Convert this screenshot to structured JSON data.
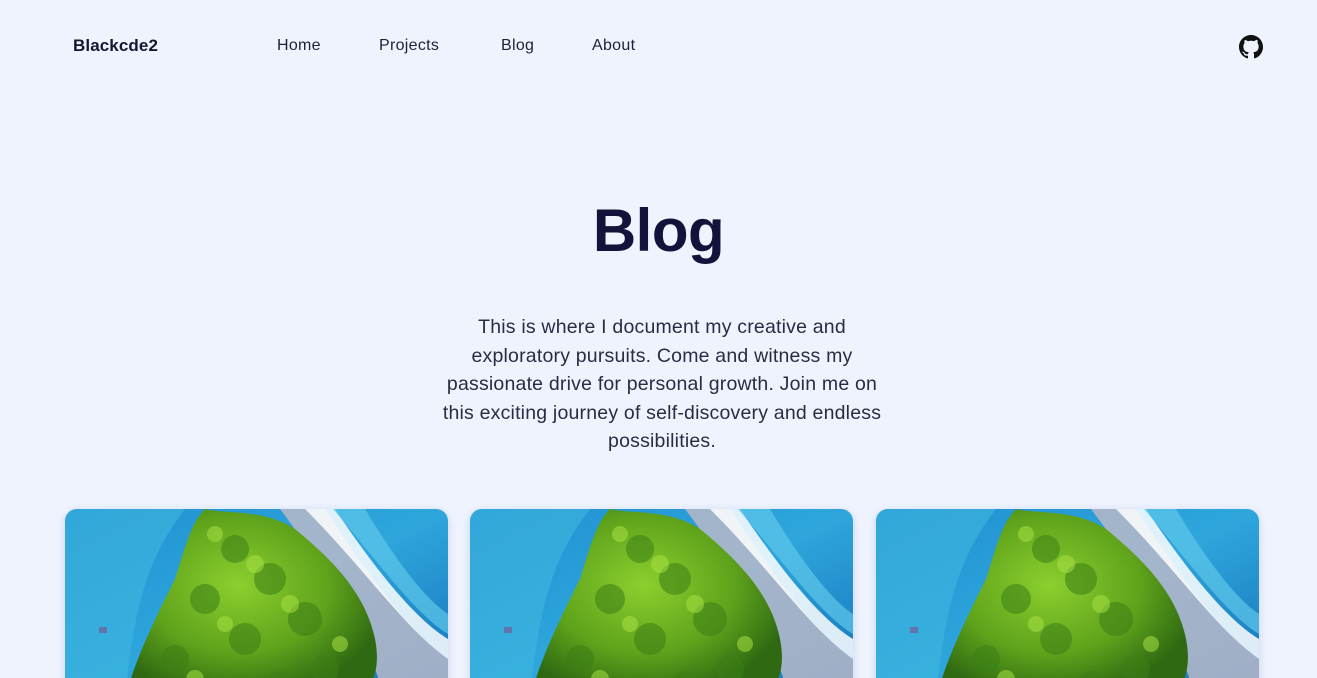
{
  "nav": {
    "brand": "Blackcde2",
    "links": [
      {
        "label": "Home"
      },
      {
        "label": "Projects"
      },
      {
        "label": "Blog"
      },
      {
        "label": "About"
      }
    ],
    "github_icon": "github-icon"
  },
  "hero": {
    "title": "Blog",
    "description": "This is where I document my creative and exploratory pursuits. Come and witness my passionate drive for personal growth. Join me on this exciting journey of self-discovery and endless possibilities."
  },
  "cards": [
    {
      "image": "island-aerial-image"
    },
    {
      "image": "island-aerial-image"
    },
    {
      "image": "island-aerial-image"
    }
  ],
  "colors": {
    "background": "#eef3fe",
    "title": "#12123a",
    "text": "#2b2b45"
  }
}
